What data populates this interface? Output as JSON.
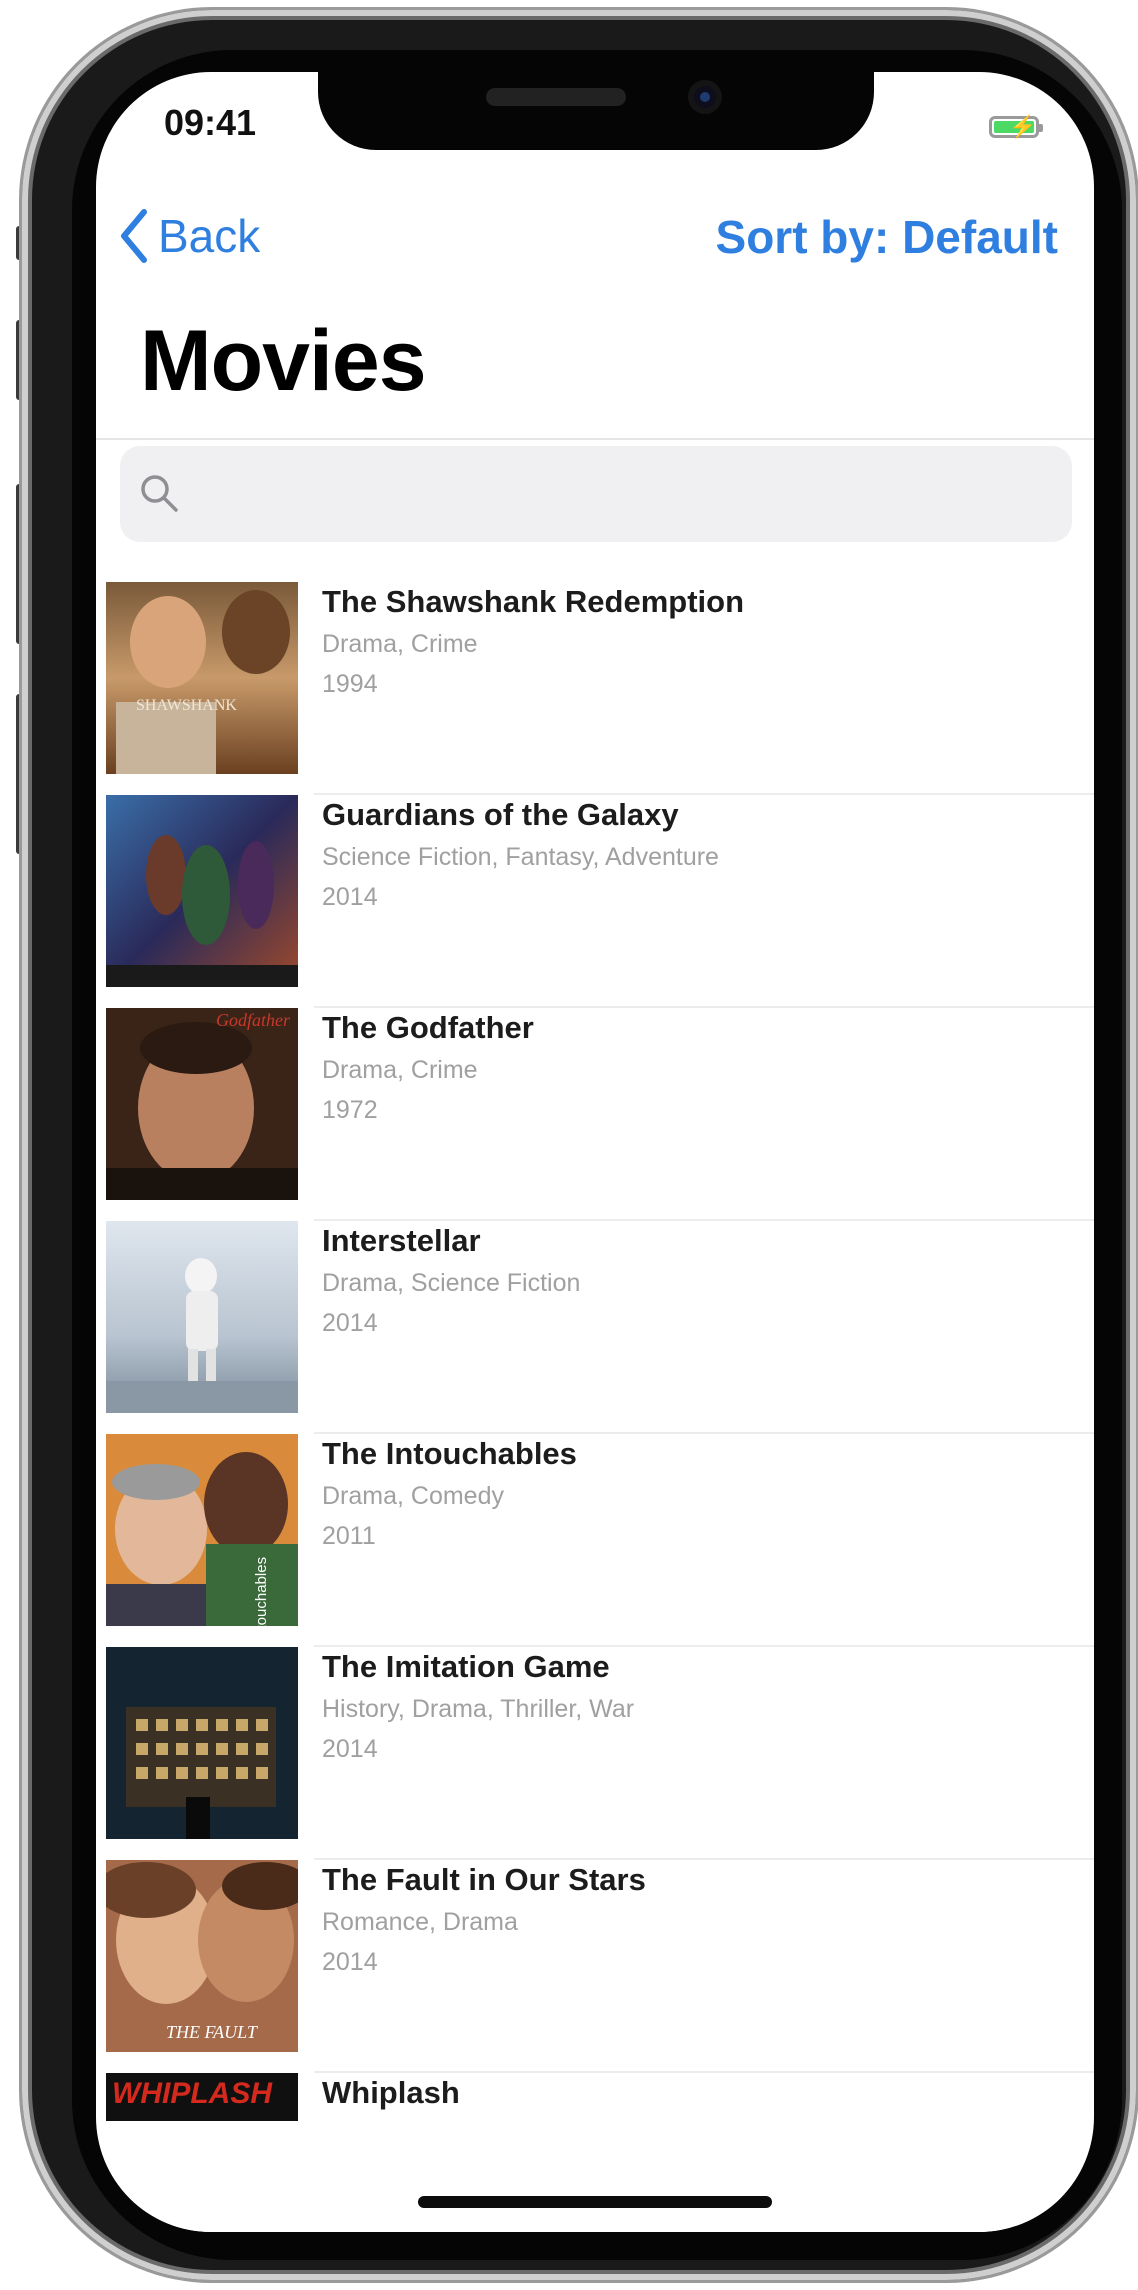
{
  "status_bar": {
    "time": "09:41",
    "battery_icon": "battery-charging-icon"
  },
  "nav": {
    "back_label": "Back",
    "sort_label": "Sort by: Default"
  },
  "page": {
    "title": "Movies"
  },
  "search": {
    "placeholder": ""
  },
  "colors": {
    "accent": "#2f7fe0",
    "secondary_text": "#a0a0a0",
    "battery": "#4cd964"
  },
  "movies": [
    {
      "title": "The Shawshank Redemption",
      "genres": "Drama, Crime",
      "year": "1994",
      "poster_text": "SHAWSHANK"
    },
    {
      "title": "Guardians of the Galaxy",
      "genres": "Science Fiction, Fantasy, Adventure",
      "year": "2014"
    },
    {
      "title": "The Godfather",
      "genres": "Drama, Crime",
      "year": "1972",
      "poster_text": "Godfather"
    },
    {
      "title": "Interstellar",
      "genres": "Drama, Science Fiction",
      "year": "2014"
    },
    {
      "title": "The Intouchables",
      "genres": "Drama, Comedy",
      "year": "2011",
      "poster_text": "Intouchables"
    },
    {
      "title": "The Imitation Game",
      "genres": "History, Drama, Thriller, War",
      "year": "2014"
    },
    {
      "title": "The Fault in Our Stars",
      "genres": "Romance, Drama",
      "year": "2014",
      "poster_text": "THE FAULT"
    },
    {
      "title": "Whiplash",
      "poster_text": "WHIPLASH"
    }
  ]
}
